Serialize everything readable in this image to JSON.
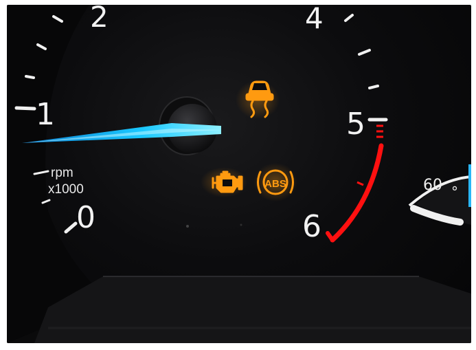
{
  "dashboard": {
    "tachometer": {
      "scale_labels": [
        "0",
        "1",
        "2",
        "4",
        "5",
        "6"
      ],
      "unit_top": "rpm",
      "unit_bottom": "x1000",
      "needle_color": "#19c8ff",
      "redline_color": "#ff1010"
    },
    "warning_lights": {
      "color": "#ff9a10",
      "abs_label": "ABS",
      "icons": [
        "traction-control-icon",
        "check-engine-icon",
        "abs-warning-icon"
      ]
    },
    "temperature_gauge": {
      "label": "60",
      "degree_symbol": "°",
      "accent_color": "#29b6f6"
    }
  }
}
